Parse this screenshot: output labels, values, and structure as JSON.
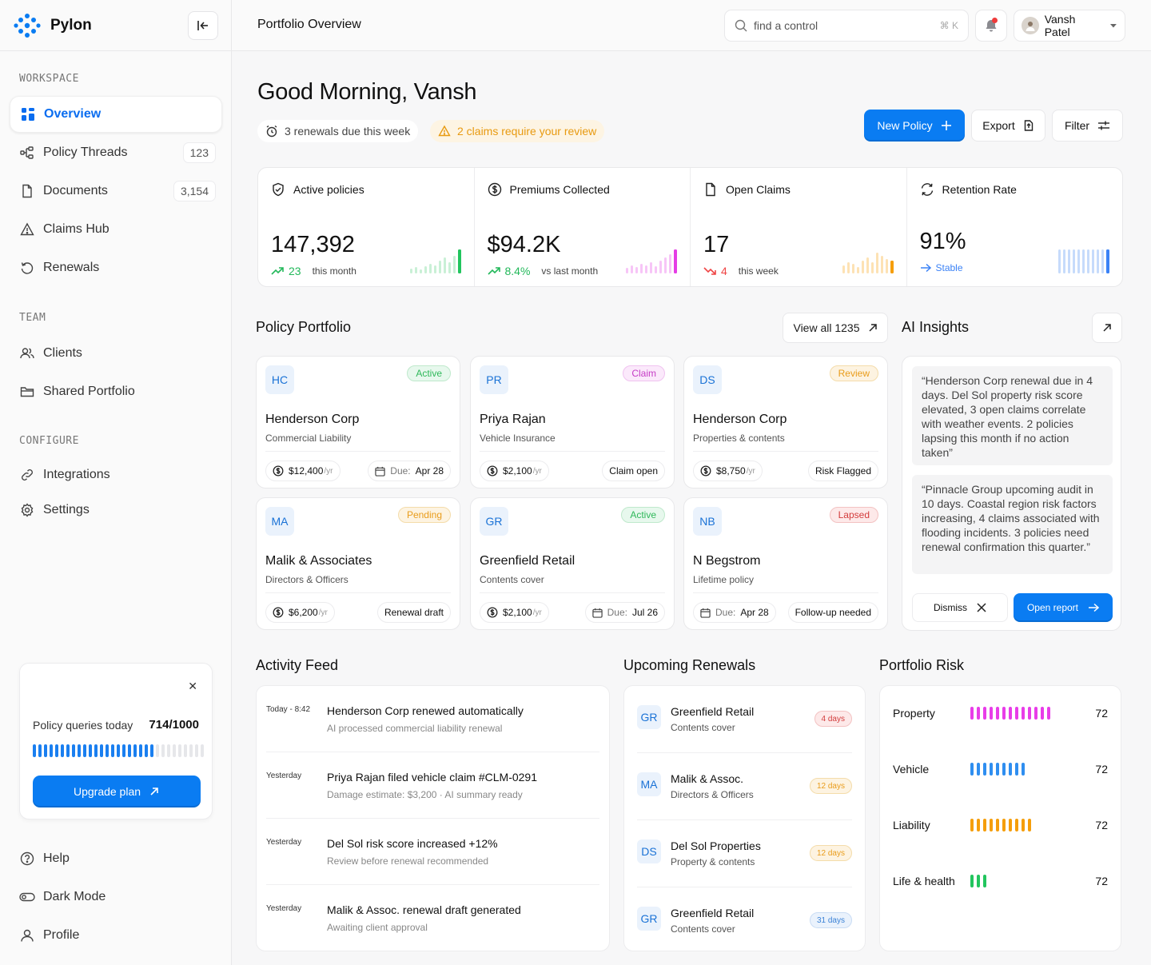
{
  "app": {
    "name": "Pylon"
  },
  "sidebar": {
    "sections": {
      "workspace": "WORKSPACE",
      "team": "TEAM",
      "configure": "CONFIGURE"
    },
    "workspace_items": [
      {
        "label": "Overview",
        "icon": "grid-icon",
        "active": true
      },
      {
        "label": "Policy Threads",
        "icon": "threads-icon",
        "count": "123"
      },
      {
        "label": "Documents",
        "icon": "document-icon",
        "count": "3,154"
      },
      {
        "label": "Claims Hub",
        "icon": "warning-icon"
      },
      {
        "label": "Renewals",
        "icon": "renew-icon"
      }
    ],
    "team_items": [
      {
        "label": "Clients",
        "icon": "users-icon"
      },
      {
        "label": "Shared Portfolio",
        "icon": "folder-icon"
      }
    ],
    "configure_items": [
      {
        "label": "Integrations",
        "icon": "link-icon"
      },
      {
        "label": "Settings",
        "icon": "gear-icon"
      }
    ],
    "bottom_items": [
      {
        "label": "Help",
        "icon": "help-icon"
      },
      {
        "label": "Dark Mode",
        "icon": "toggle-icon"
      },
      {
        "label": "Profile",
        "icon": "user-icon"
      }
    ],
    "quota": {
      "label": "Policy queries today",
      "value": "714/1000",
      "used": 714,
      "total": 1000,
      "button": "Upgrade plan"
    }
  },
  "topbar": {
    "title": "Portfolio Overview",
    "search_placeholder": "find a control",
    "shortcut": "⌘ K",
    "user_name": "Vansh Patel"
  },
  "header": {
    "greeting": "Good Morning, Vansh",
    "renewals_notice": "3 renewals due this week",
    "claims_notice": "2 claims require your review",
    "new_policy": "New Policy",
    "export": "Export",
    "filter": "Filter"
  },
  "kpis": [
    {
      "label": "Active policies",
      "value": "147,392",
      "delta": "23",
      "sub": "this month",
      "trend": "up",
      "color": "#22c55e",
      "faint": "#c9f0d6",
      "bars": [
        6,
        8,
        5,
        9,
        12,
        10,
        16,
        20,
        14,
        22,
        30
      ]
    },
    {
      "label": "Premiums Collected",
      "value": "$94.2K",
      "delta": "8.4%",
      "sub": "vs last month",
      "trend": "up",
      "color": "#e53de5",
      "faint": "#f7c5f7",
      "bars": [
        7,
        10,
        8,
        12,
        10,
        14,
        9,
        16,
        20,
        24,
        30
      ]
    },
    {
      "label": "Open Claims",
      "value": "17",
      "delta": "4",
      "sub": "this week",
      "trend": "down",
      "color": "#f59e0b",
      "faint": "#fde2b4",
      "bars": [
        10,
        14,
        12,
        8,
        16,
        20,
        14,
        26,
        22,
        18,
        16
      ]
    },
    {
      "label": "Retention Rate",
      "value": "91%",
      "delta": "Stable",
      "sub": "",
      "trend": "flat",
      "color": "#3b82f6",
      "faint": "#c6dbfb",
      "bars": [
        30,
        30,
        30,
        30,
        30,
        30,
        30,
        30,
        30,
        30,
        30
      ]
    }
  ],
  "portfolio": {
    "title": "Policy Portfolio",
    "view_all": "View all 1235",
    "cards": [
      {
        "initials": "HC",
        "status": "Active",
        "status_class": "st-green",
        "name": "Henderson Corp",
        "type": "Commercial Liability",
        "premium": "$12,400",
        "unit": "/yr",
        "right_label": "Due:",
        "right_value": "Apr 28",
        "right_kind": "due"
      },
      {
        "initials": "PR",
        "status": "Claim",
        "status_class": "st-pink",
        "name": "Priya Rajan",
        "type": "Vehicle Insurance",
        "premium": "$2,100",
        "unit": "/yr",
        "right_label": "",
        "right_value": "Claim open",
        "right_kind": "tag"
      },
      {
        "initials": "DS",
        "status": "Review",
        "status_class": "st-orange",
        "name": "Henderson Corp",
        "type": "Properties & contents",
        "premium": "$8,750",
        "unit": "/yr",
        "right_label": "",
        "right_value": "Risk Flagged",
        "right_kind": "tag"
      },
      {
        "initials": "MA",
        "status": "Pending",
        "status_class": "st-orange",
        "name": "Malik & Associates",
        "type": "Directors & Officers",
        "premium": "$6,200",
        "unit": "/yr",
        "right_label": "",
        "right_value": "Renewal draft",
        "right_kind": "tag"
      },
      {
        "initials": "GR",
        "status": "Active",
        "status_class": "st-green",
        "name": "Greenfield Retail",
        "type": "Contents cover",
        "premium": "$2,100",
        "unit": "/yr",
        "right_label": "Due:",
        "right_value": "Jul 26",
        "right_kind": "due"
      },
      {
        "initials": "NB",
        "status": "Lapsed",
        "status_class": "st-red",
        "name": "N Begstrom",
        "type": "Lifetime policy",
        "premium": "",
        "unit": "",
        "left_label": "Due:",
        "left_value": "Apr 28",
        "right_label": "",
        "right_value": "Follow-up needed",
        "right_kind": "tag"
      }
    ]
  },
  "ai": {
    "title": "AI Insights",
    "quotes": [
      "“Henderson Corp renewal due in 4 days. Del Sol property risk score elevated, 3 open claims correlate with weather events. 2 policies lapsing this month if no action taken”",
      "“Pinnacle Group upcoming audit in 10 days. Coastal region risk factors increasing, 4 claims associated with flooding incidents. 3 policies need renewal confirmation this quarter.”"
    ],
    "dismiss": "Dismiss",
    "open_report": "Open report"
  },
  "activity": {
    "title": "Activity Feed",
    "items": [
      {
        "time": "Today - 8:42",
        "title": "Henderson Corp renewed automatically",
        "sub": "AI processed commercial liability renewal"
      },
      {
        "time": "Yesterday",
        "title": "Priya Rajan filed vehicle claim #CLM-0291",
        "sub": "Damage estimate: $3,200 · AI summary ready"
      },
      {
        "time": "Yesterday",
        "title": "Del Sol risk score increased +12%",
        "sub": "Review before renewal recommended"
      },
      {
        "time": "Yesterday",
        "title": "Malik & Assoc. renewal draft generated",
        "sub": "Awaiting client approval"
      }
    ]
  },
  "renewals": {
    "title": "Upcoming Renewals",
    "items": [
      {
        "initials": "GR",
        "name": "Greenfield Retail",
        "type": "Contents cover",
        "badge": "4 days",
        "badge_class": "b-red"
      },
      {
        "initials": "MA",
        "name": "Malik & Assoc.",
        "type": "Directors & Officers",
        "badge": "12 days",
        "badge_class": "b-orange"
      },
      {
        "initials": "DS",
        "name": "Del Sol Properties",
        "type": "Property & contents",
        "badge": "12 days",
        "badge_class": "b-orange"
      },
      {
        "initials": "GR",
        "name": "Greenfield Retail",
        "type": "Contents cover",
        "badge": "31 days",
        "badge_class": "b-blue"
      }
    ]
  },
  "risk": {
    "title": "Portfolio Risk",
    "items": [
      {
        "label": "Property",
        "value": "72",
        "ticks": 13,
        "color": "#e83de8"
      },
      {
        "label": "Vehicle",
        "value": "72",
        "ticks": 9,
        "color": "#2f8ef0"
      },
      {
        "label": "Liability",
        "value": "72",
        "ticks": 10,
        "color": "#f59e0b"
      },
      {
        "label": "Life & health",
        "value": "72",
        "ticks": 3,
        "color": "#22c55e"
      }
    ]
  }
}
